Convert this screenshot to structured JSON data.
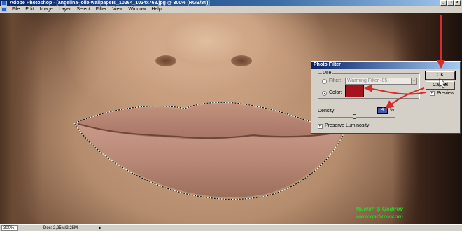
{
  "app": {
    "title": "Adobe Photoshop - [angelina-jolie-wallpapers_10264_1024x768.jpg @ 300% (RGB/8#)]",
    "window_buttons": [
      "_",
      "□",
      "×"
    ]
  },
  "menubar": {
    "items": [
      "File",
      "Edit",
      "Image",
      "Layer",
      "Select",
      "Filter",
      "View",
      "Window",
      "Help"
    ]
  },
  "dialog": {
    "title": "Photo Filter",
    "use_label": "Use",
    "filter_label": "Filter:",
    "filter_value": "Warming Filter (85)",
    "color_label": "Color:",
    "selected_option": "color",
    "swatch_color": "#a5141c",
    "density_label": "Density:",
    "density_value": "4",
    "density_unit": "%",
    "density_level": 0.47,
    "preserve_luminosity_label": "Preserve Luminosity",
    "preserve_luminosity_checked": true,
    "ok_label": "OK",
    "cancel_label": "Cancel",
    "preview_label": "Preview",
    "preview_checked": true
  },
  "statusbar": {
    "zoom": "300%",
    "doc_info": "Doc: 2,25M/2,25M",
    "arrow": "▶"
  },
  "watermark": {
    "line1": "Müəllif: Ş.Qədirov",
    "line2": "www.qadirov.com"
  },
  "annotation_color": "#d42b2b",
  "check_mark": "✓"
}
